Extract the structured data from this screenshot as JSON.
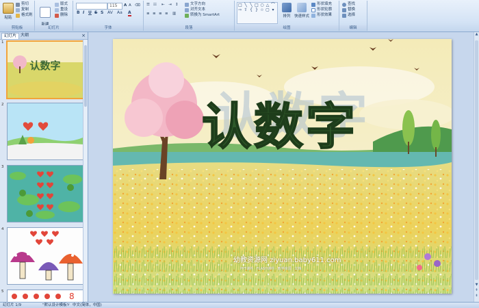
{
  "ribbon": {
    "clipboard": {
      "paste": "粘贴",
      "cut": "剪切",
      "copy": "复制",
      "format_painter": "格式刷",
      "label": "剪贴板"
    },
    "slides": {
      "new_slide": "新建\n幻灯片",
      "layout": "版式",
      "reset": "重设",
      "delete": "删除",
      "label": "幻灯片"
    },
    "font": {
      "size": "115",
      "label": "字体"
    },
    "paragraph": {
      "text_direction": "文字方向",
      "align_text": "对齐文本",
      "smartart": "转换为 SmartArt",
      "label": "段落"
    },
    "drawing": {
      "arrange": "排列",
      "quick_styles": "快速样式",
      "shape_fill": "形状填充",
      "shape_outline": "形状轮廓",
      "shape_effects": "形状效果",
      "label": "绘图"
    },
    "editing": {
      "find": "查找",
      "replace": "替换",
      "select": "选择",
      "label": "编辑"
    }
  },
  "pane": {
    "tabs": [
      "幻灯片",
      "大纲"
    ],
    "close": "×",
    "slide_numbers": [
      "1",
      "2",
      "3",
      "4",
      "5"
    ],
    "bottom_digit": "8"
  },
  "slide": {
    "title": "认数字",
    "watermark_main": "幼教资源网 ziyuan.baby611.com",
    "watermark_sub": "PPT课件 · FLASH课件 · 教学资源 · 文档"
  },
  "status": {
    "slide_count": "幻灯片 1/9",
    "theme": "\"默认设计模板\"",
    "language": "中文(简体，中国)"
  },
  "colors": {
    "ribbon_bg": "#d4e3f5",
    "pane_bg": "#dbe6f4",
    "selected_border": "#f2a33a",
    "title_green": "#2f5a2a"
  }
}
